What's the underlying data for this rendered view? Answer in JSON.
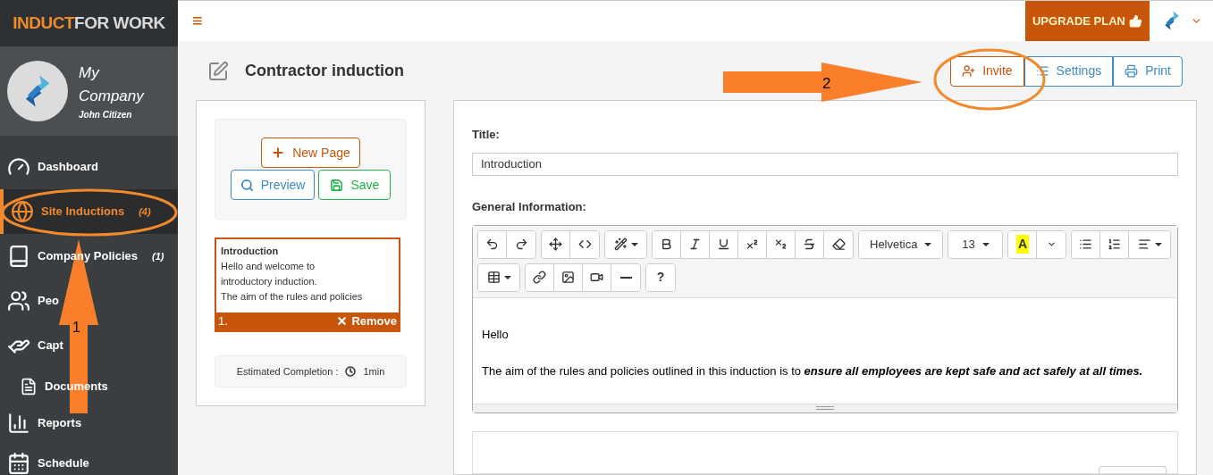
{
  "logo": {
    "accent": "INDUCT",
    "rest": "FOR WORK"
  },
  "profile": {
    "company": "My Company",
    "user": "John Citizen"
  },
  "sidebar": {
    "items": [
      {
        "kind": "dashboard",
        "label": "Dashboard",
        "selected": false
      },
      {
        "kind": "globe",
        "label": "Site Inductions",
        "count": "(4)",
        "selected": true
      },
      {
        "kind": "book",
        "label": "Company Policies",
        "count": "(1)",
        "selected": false
      },
      {
        "kind": "people",
        "label": "Peo",
        "selected": false
      },
      {
        "kind": "hand",
        "label": "Capt",
        "selected": false
      },
      {
        "kind": "document",
        "label": "Documents",
        "selected": false
      },
      {
        "kind": "reports",
        "label": "Reports",
        "selected": false
      },
      {
        "kind": "calendar",
        "label": "Schedule",
        "selected": false
      }
    ]
  },
  "topbar": {
    "menu": "≡",
    "upgrade": "UPGRADE PLAN"
  },
  "page": {
    "title": "Contractor induction",
    "actions": [
      {
        "kind": "invite",
        "label": "Invite"
      },
      {
        "kind": "settings",
        "label": "Settings"
      },
      {
        "kind": "print",
        "label": "Print"
      }
    ]
  },
  "pages_panel": {
    "new_page": "New Page",
    "preview": "Preview",
    "save": "Save",
    "pages": [
      {
        "number": "1.",
        "title": "Introduction",
        "text": "Hello and welcome to introductory induction.\nThe aim of the rules and policies",
        "remove": "Remove",
        "selected": true
      }
    ],
    "completion": {
      "label": "Estimated Completion :",
      "value": "1min"
    }
  },
  "editor": {
    "title_label": "Title:",
    "title_value": "Introduction",
    "info_label": "General Information:",
    "toolbar": [
      [
        [
          {
            "kind": "undo"
          },
          {
            "kind": "redo"
          }
        ],
        [
          {
            "kind": "move"
          },
          {
            "kind": "code"
          }
        ],
        [
          {
            "kind": "magic",
            "dropdown": true
          }
        ],
        [
          {
            "kind": "bold"
          },
          {
            "kind": "italic"
          },
          {
            "kind": "underline"
          },
          {
            "kind": "superscript"
          },
          {
            "kind": "subscript"
          },
          {
            "kind": "strike"
          },
          {
            "kind": "eraser"
          }
        ],
        [
          {
            "kind": "text",
            "label": "Helvetica",
            "dropdown": true
          }
        ],
        [
          {
            "kind": "text",
            "label": "13",
            "dropdown": true
          }
        ],
        [
          {
            "kind": "highlight",
            "label": "A"
          },
          {
            "kind": "caret"
          }
        ],
        [
          {
            "kind": "ul"
          },
          {
            "kind": "ol"
          },
          {
            "kind": "align",
            "dropdown": true
          }
        ]
      ],
      [
        [
          {
            "kind": "table",
            "dropdown": true
          }
        ],
        [
          {
            "kind": "link"
          },
          {
            "kind": "image"
          },
          {
            "kind": "video"
          },
          {
            "kind": "rule"
          }
        ],
        [
          {
            "kind": "text",
            "label": "?"
          }
        ]
      ]
    ],
    "content": [
      "Hello",
      "The aim of the rules and policies outlined in this induction is to **ensure all employees are kept safe and act safely at all times.**"
    ]
  },
  "annotations": [
    {
      "kind": "up",
      "number": "1"
    },
    {
      "kind": "right",
      "number": "2"
    }
  ]
}
